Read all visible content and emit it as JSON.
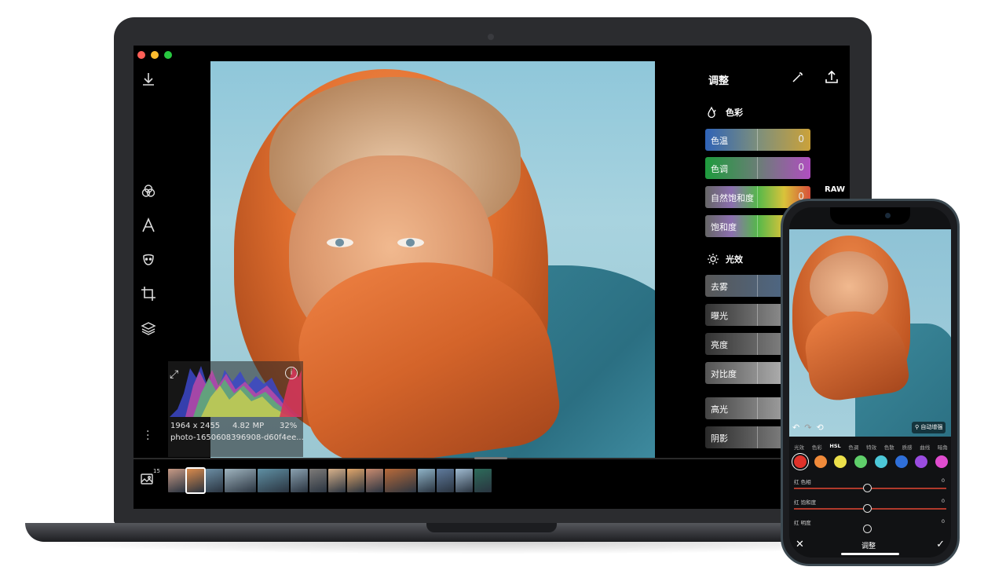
{
  "app": {
    "panel_title": "调整",
    "raw_badge": "RAW"
  },
  "icons": {
    "download": "download-icon",
    "filters": "filters-icon",
    "text": "text-icon",
    "face": "face-icon",
    "crop": "crop-icon",
    "layers": "layers-icon",
    "wand": "magic-wand-icon",
    "share": "share-icon",
    "gallery": "gallery-icon"
  },
  "histogram": {
    "dimensions": "1964 x 2455",
    "megapixels": "4.82 MP",
    "zoom": "32%",
    "filename": "photo-1650608396908-d60f4ee..."
  },
  "sections": [
    {
      "title": "色彩",
      "sliders": [
        {
          "label": "色温",
          "value": "0",
          "gradient": "linear-gradient(90deg,#2f63b7,#7d8f7c,#cba23a)"
        },
        {
          "label": "色调",
          "value": "0",
          "gradient": "linear-gradient(90deg,#1e9b3d,#6a7e76,#b04ec0)"
        },
        {
          "label": "自然饱和度",
          "value": "0",
          "gradient": "linear-gradient(90deg,#666,#8c6fb0,#55b84a,#d9c33a,#d84e3a)"
        },
        {
          "label": "饱和度",
          "value": "",
          "gradient": "linear-gradient(90deg,#666,#8c6fb0,#55b84a,#d9c33a,#d84e3a)"
        }
      ]
    },
    {
      "title": "光效",
      "sliders": [
        {
          "label": "去雾",
          "value": "",
          "gradient": "linear-gradient(90deg,#585858,#4a6b91)"
        },
        {
          "label": "曝光",
          "value": "",
          "gradient": "linear-gradient(90deg,#333,#aaa)"
        },
        {
          "label": "亮度",
          "value": "",
          "gradient": "linear-gradient(90deg,#333,#999)"
        },
        {
          "label": "对比度",
          "value": "",
          "gradient": "linear-gradient(90deg,#555,#ccc)"
        },
        {
          "label": "高光",
          "value": "",
          "gradient": "linear-gradient(90deg,#444,#bbb)"
        },
        {
          "label": "阴影",
          "value": "",
          "gradient": "linear-gradient(90deg,#2a2a2a,#999)"
        }
      ]
    }
  ],
  "filmstrip": {
    "count": "15",
    "thumbs": [
      "#c89a85",
      "#d98a4c",
      "#6b8da3",
      "#9fb4bf",
      "#5f8fa3",
      "#8aa1b0",
      "#7d7a78",
      "#d7b18a",
      "#e0a66b",
      "#c98b6f",
      "#b86a3a",
      "#8fb3c7",
      "#5f7a9c",
      "#9fbad0",
      "#2d6b5a"
    ]
  },
  "phone": {
    "auto_enhance": "自动增强",
    "tabs": [
      "光效",
      "色彩",
      "HSL",
      "色调",
      "特效",
      "色散",
      "质感",
      "曲线",
      "暗角"
    ],
    "active_tab": "HSL",
    "hsl_colors": [
      "#e0322a",
      "#f08a3a",
      "#ece04a",
      "#5fcf6a",
      "#4cc8d8",
      "#2f6fd9",
      "#9a4ce0",
      "#e04ccf"
    ],
    "rows": [
      {
        "label": "红 色相",
        "value": "0"
      },
      {
        "label": "红 饱和度",
        "value": "0"
      },
      {
        "label": "红 明度",
        "value": "0"
      }
    ],
    "bottom_title": "调整",
    "close": "✕",
    "confirm": "✓"
  }
}
